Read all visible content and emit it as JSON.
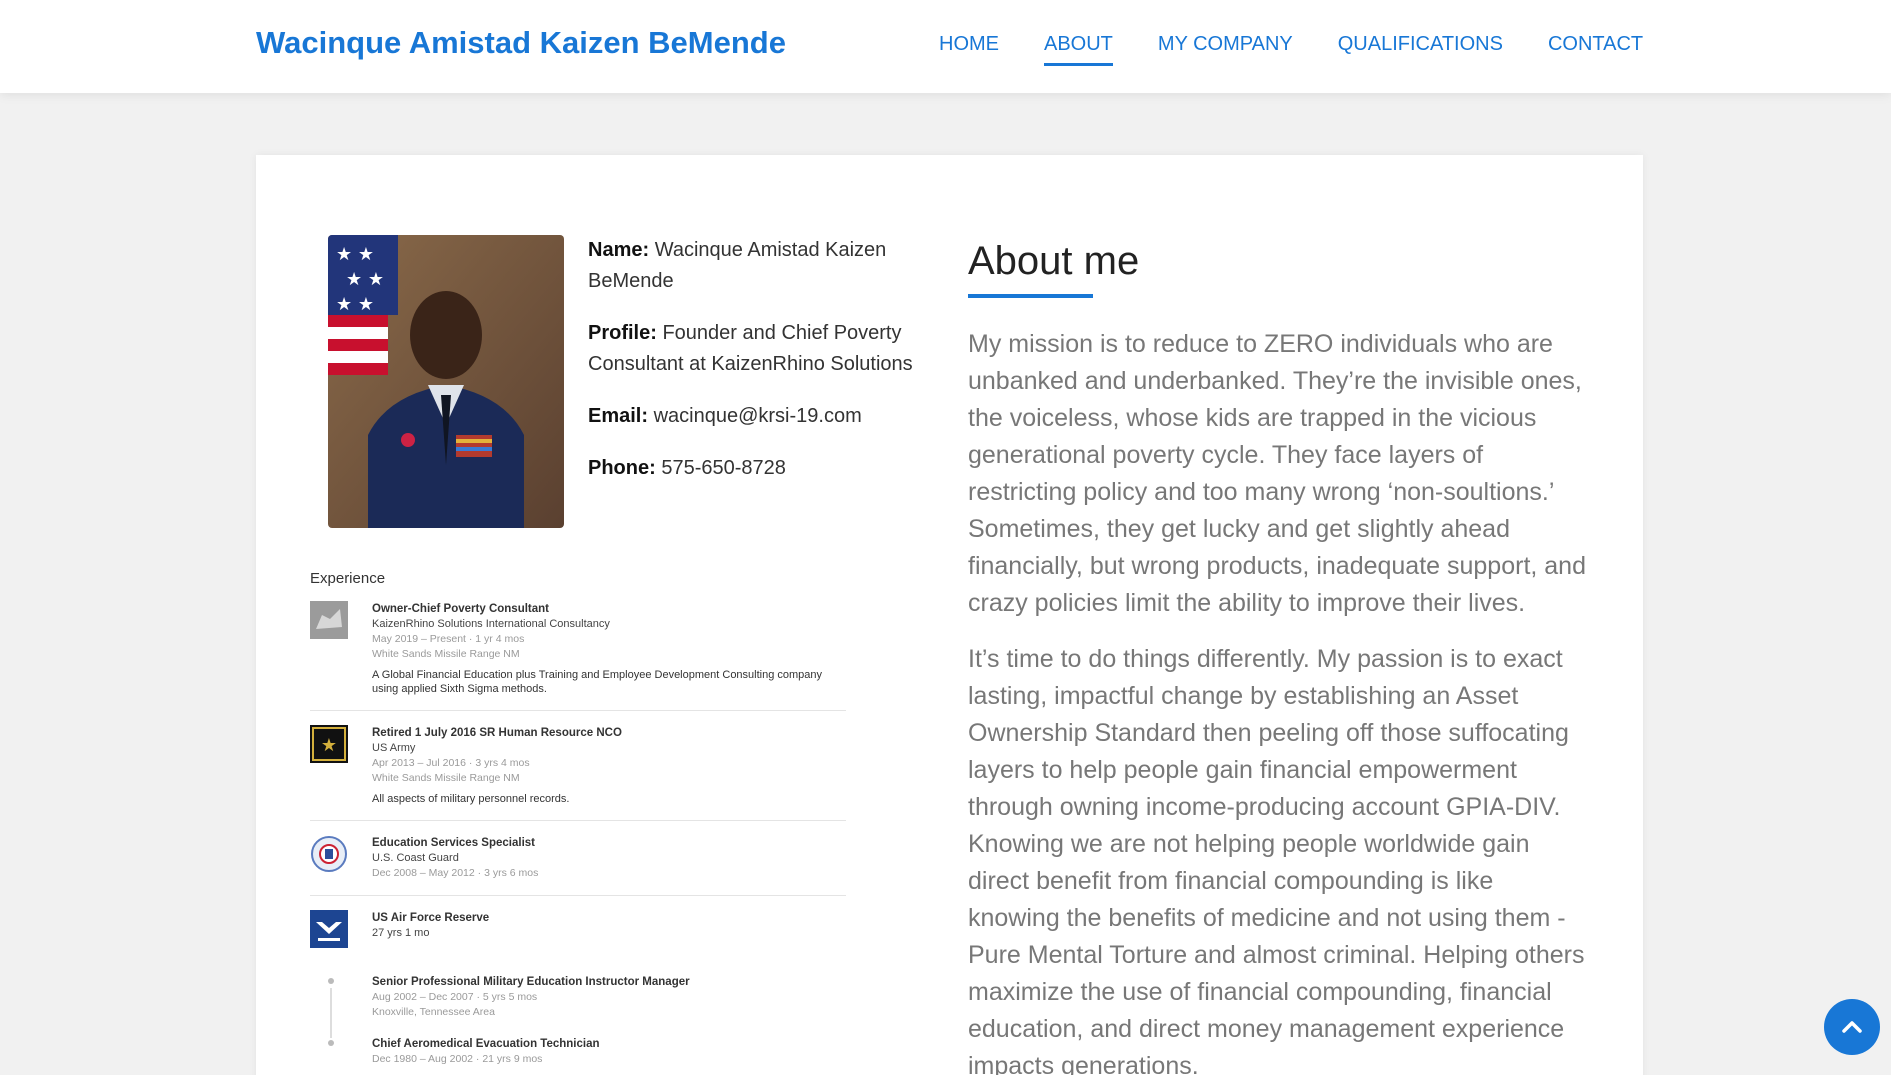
{
  "header": {
    "brand": "Wacinque Amistad Kaizen BeMende",
    "nav": [
      {
        "label": "HOME",
        "active": false
      },
      {
        "label": "ABOUT",
        "active": true
      },
      {
        "label": "MY COMPANY",
        "active": false
      },
      {
        "label": "QUALIFICATIONS",
        "active": false
      },
      {
        "label": "CONTACT",
        "active": false
      }
    ]
  },
  "profile": {
    "name_label": "Name:",
    "name_value": "Wacinque Amistad Kaizen BeMende",
    "profile_label": "Profile:",
    "profile_value": "Founder and Chief Poverty Consultant at KaizenRhino Solutions",
    "email_label": "Email:",
    "email_value": "wacinque@krsi-19.com",
    "phone_label": "Phone:",
    "phone_value": "575-650-8728"
  },
  "experience": {
    "title": "Experience",
    "jobs": [
      {
        "title": "Owner-Chief Poverty Consultant",
        "company": "KaizenRhino Solutions International Consultancy",
        "dates": "May 2019 – Present · 1 yr 4 mos",
        "location": "White Sands Missile Range NM",
        "description": "A Global Financial Education plus Training and Employee Development Consulting company using applied Sixth Sigma methods."
      },
      {
        "title": "Retired 1 July 2016 SR Human Resource NCO",
        "company": "US Army",
        "dates": "Apr 2013 – Jul 2016 · 3 yrs 4 mos",
        "location": "White Sands Missile Range NM",
        "description": "All aspects of military personnel records."
      },
      {
        "title": "Education Services Specialist",
        "company": "U.S. Coast Guard",
        "dates": "Dec 2008 – May 2012 · 3 yrs 6 mos"
      },
      {
        "title": "US Air Force Reserve",
        "duration": "27 yrs 1 mo",
        "roles": [
          {
            "title": "Senior Professional Military Education Instructor Manager",
            "dates": "Aug 2002 – Dec 2007 · 5 yrs 5 mos",
            "location": "Knoxville, Tennessee Area"
          },
          {
            "title": "Chief Aeromedical Evacuation Technician",
            "dates": "Dec 1980 – Aug 2002 · 21 yrs 9 mos"
          }
        ]
      }
    ]
  },
  "about": {
    "heading": "About me",
    "p1": "My mission is to reduce to ZERO individuals who are unbanked and underbanked. They’re the invisible ones, the voiceless, whose kids are trapped in the vicious generational poverty cycle. They face layers of restricting policy and too many wrong ‘non-soultions.’ Sometimes, they get lucky and get slightly ahead financially, but wrong products, inadequate support, and crazy policies limit the ability to improve their lives.",
    "p2": "It’s time to do things differently. My passion is to exact lasting, impactful change by establishing an Asset Ownership Standard then peeling off those suffocating layers to help people gain financial empowerment through owning income-producing account GPIA-DIV. Knowing we are not helping people worldwide gain direct benefit from financial compounding is like knowing the benefits of medicine and not using them - Pure Mental Torture and almost criminal. Helping others maximize the use of financial compounding, financial education, and direct money management experience impacts generations."
  },
  "colors": {
    "accent": "#1877d6",
    "background": "#f1f1f1"
  },
  "icons": {
    "back_to_top": "chevron-up-icon"
  }
}
